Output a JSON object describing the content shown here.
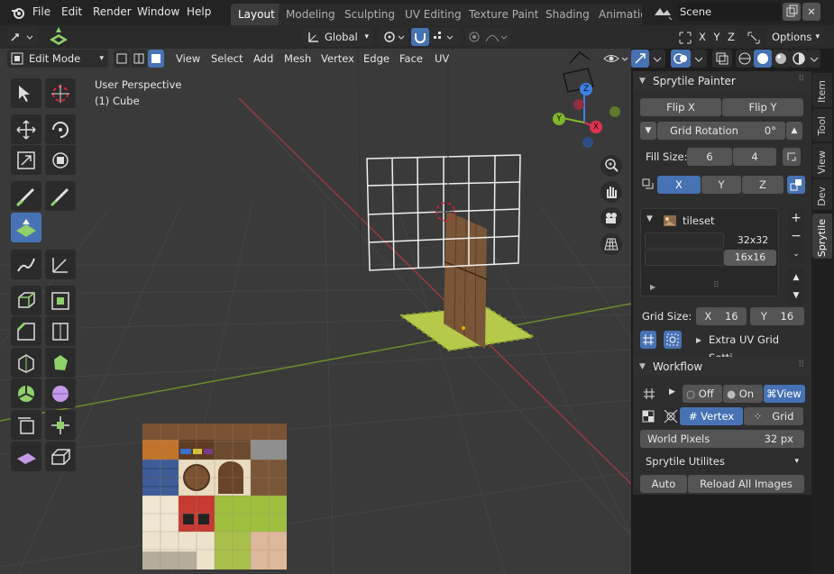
{
  "topbar": {
    "menus": [
      "File",
      "Edit",
      "Render",
      "Window",
      "Help"
    ],
    "workspace_tabs": [
      "Layout",
      "Modeling",
      "Sculpting",
      "UV Editing",
      "Texture Paint",
      "Shading",
      "Animatio"
    ],
    "scene_name": "Scene"
  },
  "header": {
    "transform_orientation": "Global",
    "xyz": [
      "X",
      "Y",
      "Z"
    ],
    "options_label": "Options",
    "mode": "Edit Mode",
    "menus": [
      "View",
      "Select",
      "Add",
      "Mesh",
      "Vertex",
      "Edge",
      "Face",
      "UV"
    ]
  },
  "viewport": {
    "perspective_label": "User Perspective",
    "object_label": "(1) Cube",
    "gizmo": {
      "x": "X",
      "y": "Y",
      "z": "Z"
    }
  },
  "panel": {
    "title": "Sprytile Painter",
    "flip_x": "Flip X",
    "flip_y": "Flip Y",
    "grid_rotation_label": "Grid Rotation",
    "grid_rotation_value": "0°",
    "fill_size_label": "Fill Size:",
    "fill_w": "6",
    "fill_h": "4",
    "axis_options": [
      "X",
      "Y",
      "Z"
    ],
    "tileset_name": "tileset",
    "grid_options": [
      "32x32",
      "16x16"
    ],
    "grid_size_label": "Grid Size:",
    "grid_x_label": "X",
    "grid_x": "16",
    "grid_y_label": "Y",
    "grid_y": "16",
    "extra_grid": "Extra UV Grid Setti..."
  },
  "workflow": {
    "title": "Workflow",
    "off": "Off",
    "on": "On",
    "view": "View",
    "vertex": "Vertex",
    "grid": "Grid",
    "world_pixels_label": "World Pixels",
    "world_pixels_value": "32 px",
    "utilities": "Sprytile Utilites",
    "auto": "Auto",
    "reload": "Reload All Images"
  },
  "sidetabs": [
    "Item",
    "Tool",
    "View",
    "Dev",
    "Sprytile"
  ],
  "colors": {
    "accent": "#4772b3",
    "panel": "#2e2e2e",
    "viewport": "#3a3a3a",
    "x_axis": "#e0334f",
    "y_axis": "#7fb82a",
    "z_axis": "#3a82e6"
  }
}
